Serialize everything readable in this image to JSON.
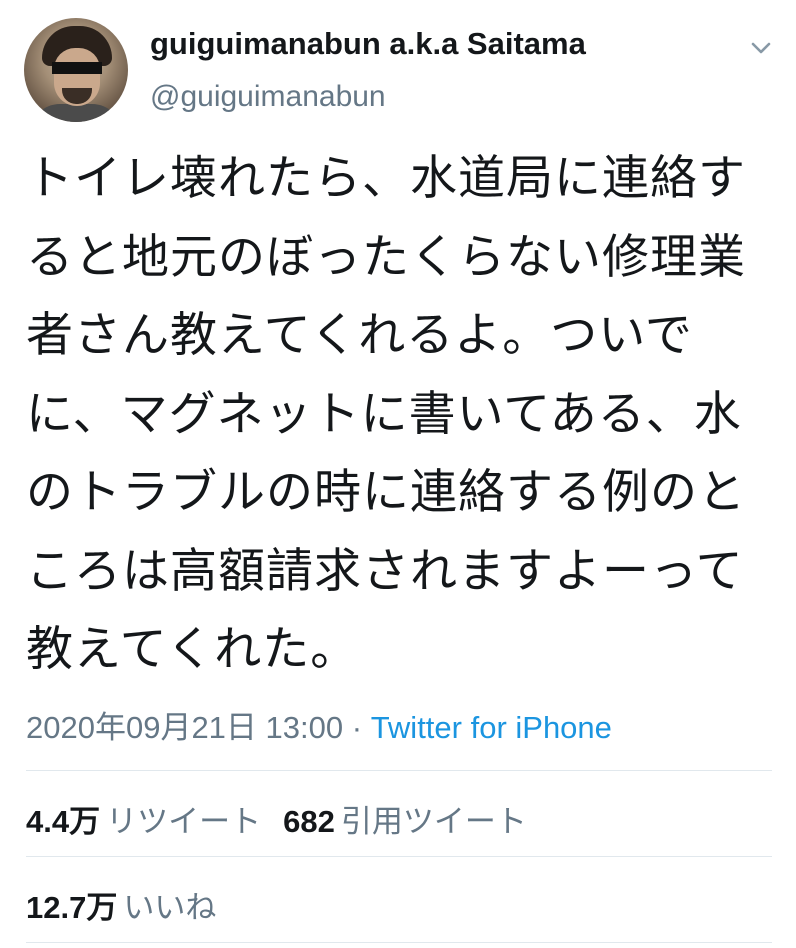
{
  "user": {
    "display_name": "guiguimanabun a.k.a Saitama",
    "handle": "@guiguimanabun",
    "avatar_icon": "profile-photo"
  },
  "menu_icon": "chevron-down-icon",
  "tweet": {
    "text": "トイレ壊れたら、水道局に連絡すると地元のぼったくらない修理業者さん教えてくれるよ。ついでに、マグネットに書いてある、水のトラブルの時に連絡する例のところは高額請求されますよーって教えてくれた。"
  },
  "meta": {
    "timestamp": "2020年09月21日 13:00",
    "separator": " · ",
    "source": "Twitter for iPhone"
  },
  "stats": {
    "retweets_count": "4.4万",
    "retweets_label": "リツイート",
    "quotes_count": "682",
    "quotes_label": "引用ツイート",
    "likes_count": "12.7万",
    "likes_label": "いいね"
  },
  "colors": {
    "text": "#14171a",
    "secondary": "#657786",
    "link": "#1b95e0",
    "divider": "#e1e8ed"
  }
}
